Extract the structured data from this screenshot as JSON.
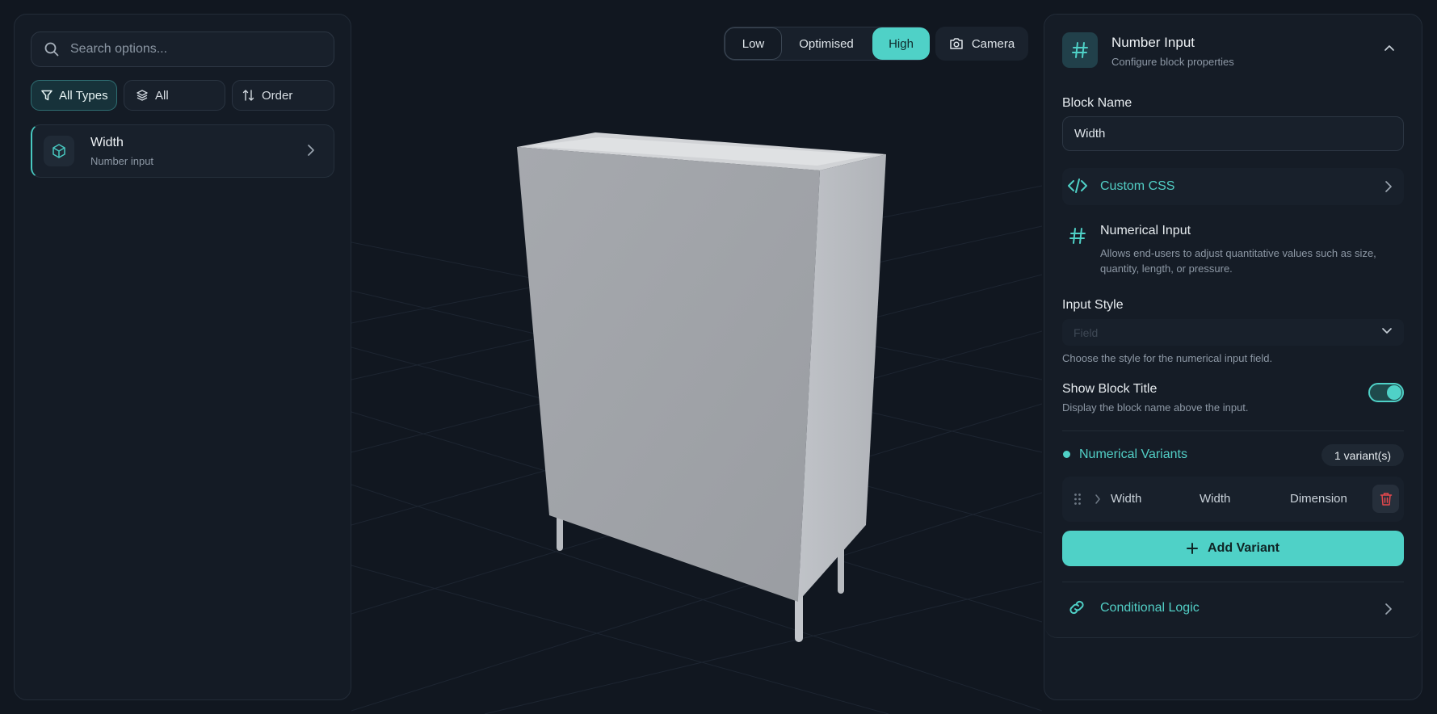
{
  "search": {
    "placeholder": "Search options..."
  },
  "filters": [
    {
      "label": "All Types",
      "active": true
    },
    {
      "label": "All",
      "active": false
    },
    {
      "label": "Order",
      "active": false
    }
  ],
  "block_list": [
    {
      "title": "Width",
      "subtitle": "Number input"
    }
  ],
  "quality": {
    "options": [
      "Low",
      "Optimised",
      "High"
    ],
    "selected": "High"
  },
  "camera": {
    "label": "Camera"
  },
  "panel": {
    "title": "Number Input",
    "subtitle": "Configure block properties",
    "block_name_label": "Block Name",
    "block_name_value": "Width",
    "custom_css_label": "Custom CSS",
    "info_title": "Numerical Input",
    "info_desc": "Allows end-users to adjust quantitative values such as size, quantity, length, or pressure.",
    "input_style_label": "Input Style",
    "input_style_value": "Field",
    "input_style_hint": "Choose the style for the numerical input field.",
    "show_title_label": "Show Block Title",
    "show_title_hint": "Display the block name above the input.",
    "show_title_on": true,
    "variants_title": "Numerical Variants",
    "variants_count": "1 variant(s)",
    "variants": [
      {
        "name": "Width",
        "label": "Width",
        "type": "Dimension"
      }
    ],
    "add_variant_label": "Add Variant",
    "conditional_logic_label": "Conditional Logic"
  },
  "colors": {
    "accent": "#4fd1c7",
    "background": "#111720",
    "panel": "#141b25",
    "danger": "#e5484d"
  }
}
